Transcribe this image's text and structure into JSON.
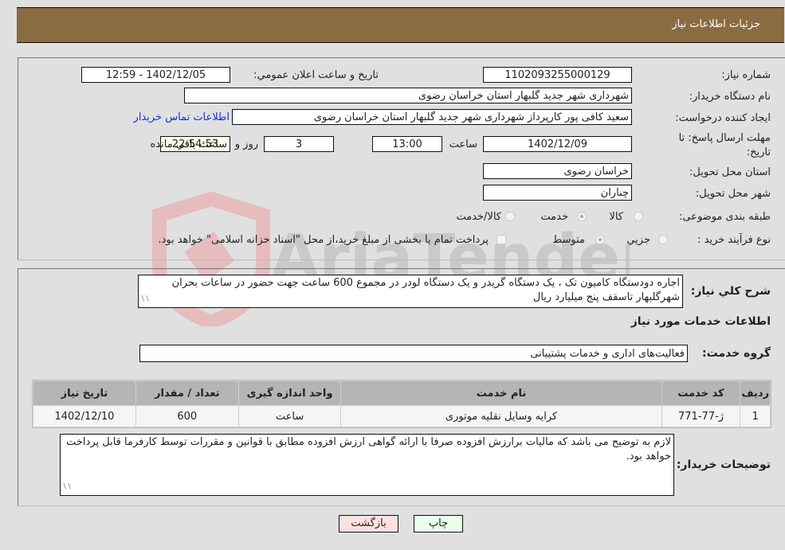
{
  "header": {
    "title": "جزئیات اطلاعات نیاز"
  },
  "form": {
    "need_number": {
      "label": "شماره نیاز:",
      "value": "1102093255000129"
    },
    "announce": {
      "label": "تاریخ و ساعت اعلان عمومي:",
      "value": "1402/12/05 - 12:59"
    },
    "buyer_org": {
      "label": "نام دستگاه خریدار:",
      "value": "شهرداری شهر جدید گلبهار استان خراسان رضوی"
    },
    "creator": {
      "label": "ایجاد کننده درخواست:",
      "value": "سعید کافی پور کارپرداز شهرداری شهر جدید گلبهار استان خراسان رضوی",
      "contact_link": "اطلاعات تماس خریدار"
    },
    "deadline": {
      "label": "مهلت ارسال پاسخ: تا تاریخ:",
      "date": "1402/12/09",
      "time_label": "ساعت",
      "time": "13:00",
      "days": "3",
      "days_label": "روز و",
      "remaining": "22:54:53",
      "remaining_label": "ساعت باقي مانده"
    },
    "province": {
      "label": "استان محل تحویل:",
      "value": "خراسان رضوی"
    },
    "city": {
      "label": "شهر محل تحویل:",
      "value": "چناران"
    },
    "category": {
      "label": "طبقه بندی موضوعی:",
      "options": [
        "کالا",
        "خدمت",
        "کالا/خدمت"
      ],
      "selected": "خدمت"
    },
    "process": {
      "label": "نوع فرآیند خرید :",
      "options": [
        "جزیي",
        "متوسط"
      ],
      "selected": "متوسط",
      "treasury_note": "پرداخت تمام یا بخشی از مبلغ خرید،از محل \"اسناد خزانه اسلامی\" خواهد بود."
    }
  },
  "details": {
    "description_label": "شرح کلي نیاز:",
    "description": "اجاره دودستگاه کامیون تک ، یک دستگاه گریدر و یک دستگاه لودر در مجموع 600 ساعت جهت حضور در ساعات بحران شهرگلبهار تاسقف پنج میلیارد ریال",
    "services_heading": "اطلاعات خدمات مورد نیاز",
    "service_group_label": "گروه خدمت:",
    "service_group": "فعالیت‌های اداری و خدمات پشتیبانی",
    "table": {
      "headers": [
        "ردیف",
        "کد خدمت",
        "نام خدمت",
        "واحد اندازه گیری",
        "تعداد / مقدار",
        "تاریخ نیاز"
      ],
      "rows": [
        [
          "1",
          "ژ-77-771",
          "کرایه وسایل نقلیه موتوری",
          "ساعت",
          "600",
          "1402/12/10"
        ]
      ]
    },
    "buyer_notes_label": "توضیحات خریدار:",
    "buyer_notes": "لازم به توضیح می باشد که مالیات برارزش افزوده صرفا با ارائه گواهی ارزش افزوده مطابق با قوانین و مقررات توسط کارفرما قابل پرداخت خواهد بود."
  },
  "buttons": {
    "print": "چاپ",
    "back": "بازگشت"
  },
  "watermark": {
    "text": "AriaTender.neT"
  },
  "colors": {
    "header_bg": "#8b6b42",
    "link": "#1a2fd0",
    "print_bg": "#eaffea",
    "back_bg": "#ffe0e0"
  }
}
